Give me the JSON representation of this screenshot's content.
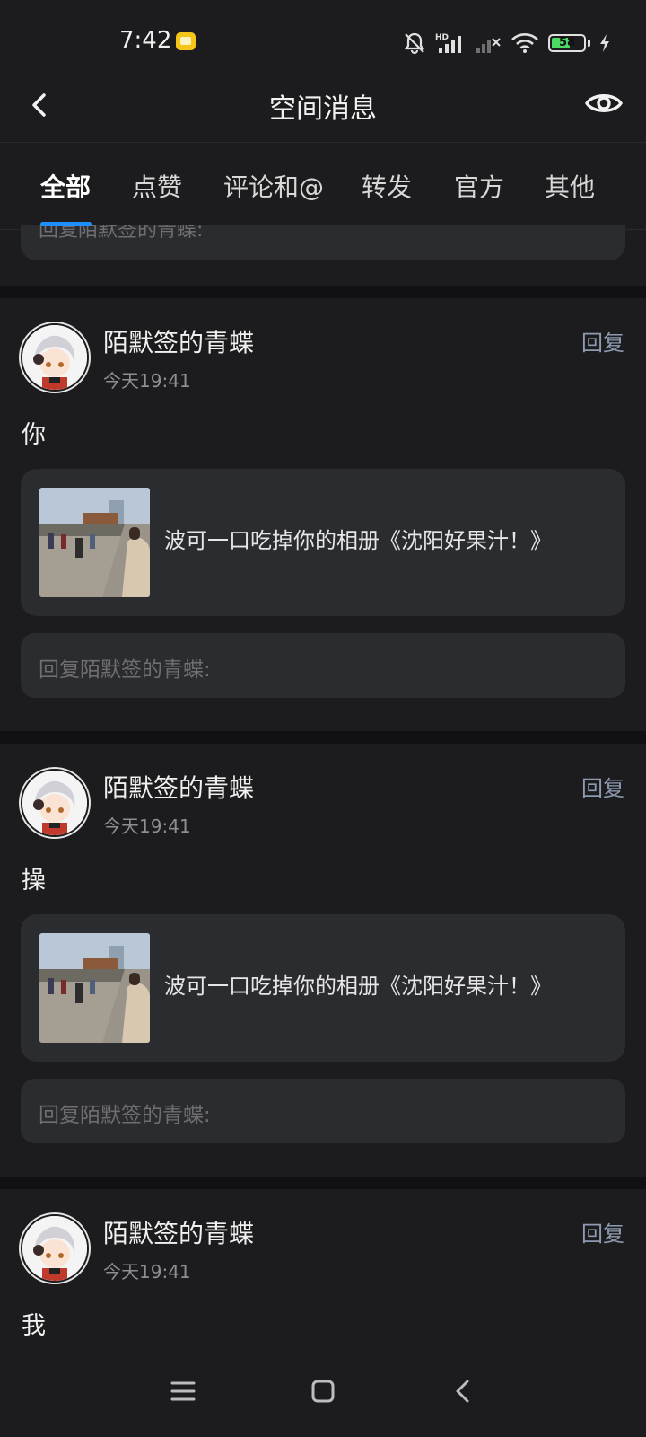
{
  "status_bar": {
    "time": "7:42",
    "battery": "58",
    "battery_level": 0.58,
    "icons": [
      "notification-badge-icon",
      "bell-muted-icon",
      "hd-signal-icon",
      "signal-off-icon",
      "wifi-icon",
      "battery-icon",
      "charging-icon"
    ]
  },
  "header": {
    "title": "空间消息",
    "back_icon": "chevron-left-icon",
    "eye_icon": "eye-icon"
  },
  "tabs": [
    {
      "label": "全部",
      "active": true
    },
    {
      "label": "点赞",
      "active": false
    },
    {
      "label": "评论和@",
      "active": false
    },
    {
      "label": "转发",
      "active": false
    },
    {
      "label": "官方",
      "active": false
    },
    {
      "label": "其他",
      "active": false
    }
  ],
  "partial_reply_placeholder": "回复陌默签的青蝶:",
  "posts": [
    {
      "user": "陌默签的青蝶",
      "time": "今天19:41",
      "reply_label": "回复",
      "comment": "你",
      "album": "波可一口吃掉你的相册《沈阳好果汁！》",
      "reply_placeholder": "回复陌默签的青蝶:"
    },
    {
      "user": "陌默签的青蝶",
      "time": "今天19:41",
      "reply_label": "回复",
      "comment": "操",
      "album": "波可一口吃掉你的相册《沈阳好果汁！》",
      "reply_placeholder": "回复陌默签的青蝶:"
    },
    {
      "user": "陌默签的青蝶",
      "time": "今天19:41",
      "reply_label": "回复",
      "comment": "我"
    }
  ],
  "nav_bar": [
    "menu-icon",
    "home-square-icon",
    "back-triangle-icon"
  ],
  "colors": {
    "background": "#1c1c1e",
    "card": "#2b2c2f",
    "separator": "#111113",
    "accent": "#1f8fff",
    "reply_link": "#8e9ab0",
    "muted_text": "#8e8e93"
  }
}
